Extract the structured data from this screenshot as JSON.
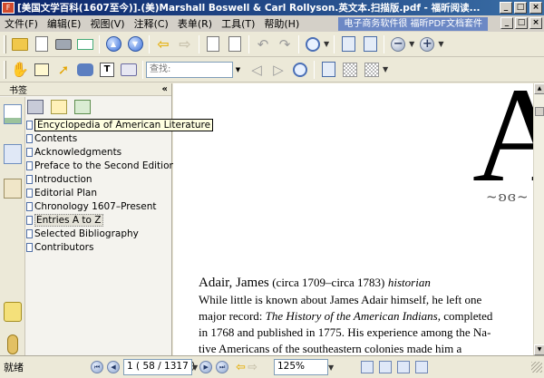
{
  "window": {
    "title": "[美国文学百科(1607至今)].(美)Marshall Boswell & Carl Rollyson.英文本.扫描版.pdf - 福昕阅读..."
  },
  "menu": {
    "items": [
      "文件(F)",
      "编辑(E)",
      "视图(V)",
      "注释(C)",
      "表单(R)",
      "工具(T)",
      "帮助(H)"
    ],
    "ad_text": "电子商务软件很 福昕PDF文档套件"
  },
  "toolbar": {
    "search_placeholder": "查找:"
  },
  "sidebar": {
    "title": "书签",
    "bookmarks": [
      "Encyclopedia of American Literature",
      "Contents",
      "Acknowledgments",
      "Preface to the Second Edition",
      "Introduction",
      "Editorial Plan",
      "Chronology 1607–Present",
      "Entries A to Z",
      "Selected Bibliography",
      "Contributors"
    ],
    "tooltip_index": 0,
    "selected_index": 7
  },
  "document": {
    "big_letter": "A",
    "ornament": "~ʚɞ~",
    "heading_name": "Adair, James",
    "heading_dates": "(circa 1709–circa 1783)",
    "heading_role": "historian",
    "line1": "While little is known about James Adair himself, he left one",
    "line2_pre": "major record: ",
    "line2_italic": "The History of the American Indians,",
    "line2_post": " completed",
    "line3": "in 1768 and published in 1775. His experience among the Na-",
    "line4": "tive Americans of the southeastern colonies made him a"
  },
  "statusbar": {
    "status": "就绪",
    "page_display": "1 ( 58 / 1317 )",
    "zoom": "125%"
  }
}
